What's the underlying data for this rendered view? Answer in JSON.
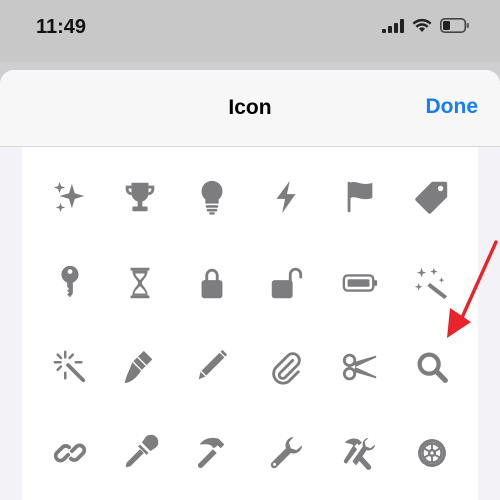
{
  "status_bar": {
    "time": "11:49"
  },
  "nav": {
    "title": "Icon",
    "done_label": "Done"
  },
  "colors": {
    "icon": "#7d7d80",
    "accent": "#1a7cf5",
    "arrow": "#e8232a"
  },
  "icons": [
    [
      "sparkles-icon",
      "trophy-icon",
      "lightbulb-icon",
      "bolt-icon",
      "flag-icon",
      "tag-icon"
    ],
    [
      "key-icon",
      "hourglass-icon",
      "lock-icon",
      "unlock-icon",
      "battery-icon",
      "magic-wand-icon"
    ],
    [
      "magic-wand-burst-icon",
      "paintbrush-icon",
      "pencil-icon",
      "paperclip-icon",
      "scissors-icon",
      "magnifying-glass-icon"
    ],
    [
      "link-icon",
      "eyedropper-icon",
      "hammer-icon",
      "wrench-icon",
      "tools-icon",
      "gear-icon"
    ]
  ]
}
